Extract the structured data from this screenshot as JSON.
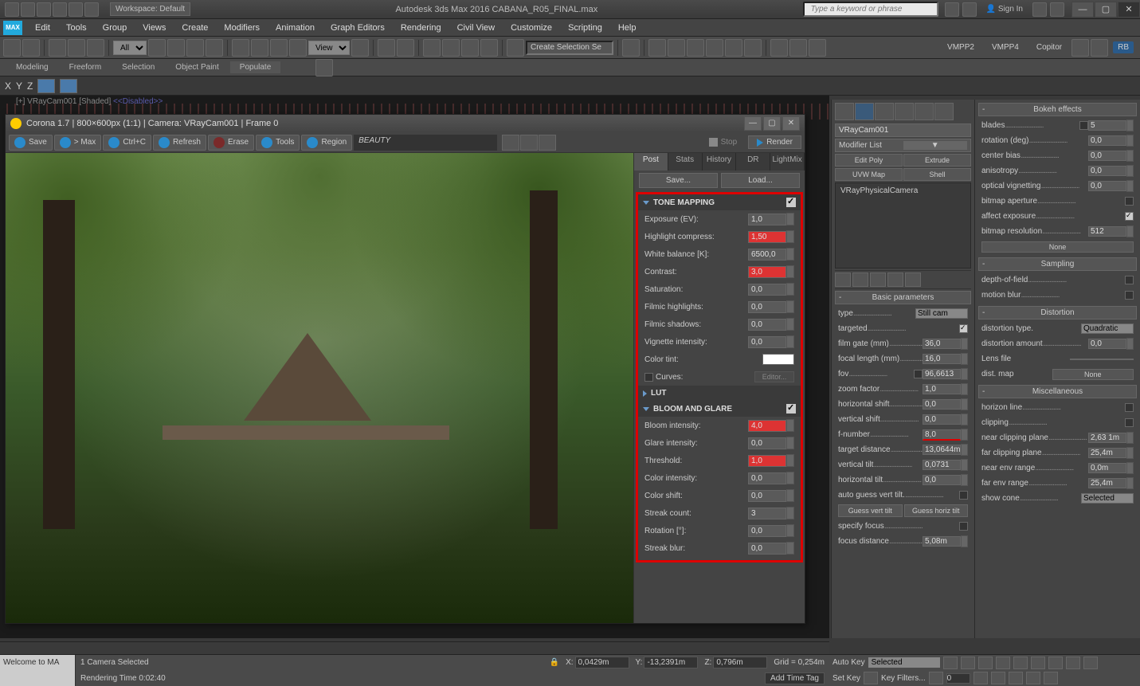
{
  "app": {
    "workspace": "Workspace: Default",
    "title": "Autodesk 3ds Max 2016   CABANA_R05_FINAL.max",
    "search_placeholder": "Type a keyword or phrase",
    "signin": "Sign In"
  },
  "menu": [
    "Edit",
    "Tools",
    "Group",
    "Views",
    "Create",
    "Modifiers",
    "Animation",
    "Graph Editors",
    "Rendering",
    "Civil View",
    "Customize",
    "Scripting",
    "Help"
  ],
  "main_toolbar": {
    "filter": "All",
    "view": "View",
    "selset": "Create Selection Se",
    "right_labels": [
      "VMPP2",
      "VMPP4",
      "Copitor"
    ]
  },
  "ribbon": [
    "Modeling",
    "Freeform",
    "Selection",
    "Object Paint",
    "Populate"
  ],
  "axis": [
    "X",
    "Y",
    "Z"
  ],
  "vp_label": {
    "cam": "[+] VRayCam001",
    "mode": "[Shaded]",
    "disabled": "<<Disabled>>"
  },
  "corona": {
    "title": "Corona 1.7 | 800×600px (1:1) | Camera: VRayCam001 | Frame 0",
    "toolbar": {
      "save": "Save",
      "tomax": "> Max",
      "ctrlc": "Ctrl+C",
      "refresh": "Refresh",
      "erase": "Erase",
      "tools": "Tools",
      "region": "Region",
      "beauty": "BEAUTY",
      "stop": "Stop",
      "render": "Render"
    },
    "tabs": [
      "Post",
      "Stats",
      "History",
      "DR",
      "LightMix"
    ],
    "save_btn": "Save...",
    "load_btn": "Load...",
    "sections": {
      "tone": "TONE MAPPING",
      "lut": "LUT",
      "bloom": "BLOOM AND GLARE"
    },
    "tone_params": [
      {
        "label": "Exposure (EV):",
        "value": "1,0",
        "hl": false
      },
      {
        "label": "Highlight compress:",
        "value": "1,50",
        "hl": true
      },
      {
        "label": "White balance [K]:",
        "value": "6500,0",
        "hl": false
      },
      {
        "label": "Contrast:",
        "value": "3,0",
        "hl": true
      },
      {
        "label": "Saturation:",
        "value": "0,0",
        "hl": false
      },
      {
        "label": "Filmic highlights:",
        "value": "0,0",
        "hl": false
      },
      {
        "label": "Filmic shadows:",
        "value": "0,0",
        "hl": false
      },
      {
        "label": "Vignette intensity:",
        "value": "0,0",
        "hl": false
      }
    ],
    "color_tint": "Color tint:",
    "curves": "Curves:",
    "editor": "Editor...",
    "bloom_params": [
      {
        "label": "Bloom intensity:",
        "value": "4,0",
        "hl": true
      },
      {
        "label": "Glare intensity:",
        "value": "0,0",
        "hl": false
      },
      {
        "label": "Threshold:",
        "value": "1,0",
        "hl": true
      },
      {
        "label": "Color intensity:",
        "value": "0,0",
        "hl": false
      },
      {
        "label": "Color shift:",
        "value": "0,0",
        "hl": false
      },
      {
        "label": "Streak count:",
        "value": "3",
        "hl": false
      },
      {
        "label": "Rotation [°]:",
        "value": "0,0",
        "hl": false
      },
      {
        "label": "Streak blur:",
        "value": "0,0",
        "hl": false
      }
    ]
  },
  "modify": {
    "obj_name": "VRayCam001",
    "modifier_list": "Modifier List",
    "buttons": [
      "Edit Poly",
      "Extrude",
      "UVW Map",
      "Shell"
    ],
    "stack_item": "VRayPhysicalCamera"
  },
  "basic_params": {
    "header": "Basic parameters",
    "rows": [
      {
        "l": "type",
        "v": "Still cam",
        "t": "drop"
      },
      {
        "l": "targeted",
        "t": "chk",
        "on": true
      },
      {
        "l": "film gate (mm)",
        "v": "36,0",
        "t": "spin"
      },
      {
        "l": "focal length (mm)",
        "v": "16,0",
        "t": "spin"
      },
      {
        "l": "fov",
        "v": "96,6613",
        "t": "chkspin"
      },
      {
        "l": "zoom factor",
        "v": "1,0",
        "t": "spin"
      },
      {
        "l": "horizontal shift",
        "v": "0,0",
        "t": "spin"
      },
      {
        "l": "vertical shift",
        "v": "0,0",
        "t": "spin"
      },
      {
        "l": "f-number",
        "v": "8,0",
        "t": "spin",
        "red": true
      },
      {
        "l": "target distance",
        "v": "13,0644m",
        "t": "spin"
      },
      {
        "l": "vertical tilt",
        "v": "0,0731",
        "t": "spin"
      },
      {
        "l": "horizontal tilt",
        "v": "0,0",
        "t": "spin"
      },
      {
        "l": "auto guess vert tilt.",
        "t": "chk",
        "on": false
      }
    ],
    "guess_vert": "Guess vert tilt",
    "guess_horiz": "Guess horiz tilt",
    "specify_focus": "specify focus",
    "focus_distance": {
      "l": "focus distance",
      "v": "5,08m"
    }
  },
  "bokeh": {
    "header": "Bokeh effects",
    "rows": [
      {
        "l": "blades",
        "v": "5",
        "t": "chkspin"
      },
      {
        "l": "rotation (deg)",
        "v": "0,0",
        "t": "spin"
      },
      {
        "l": "center bias",
        "v": "0,0",
        "t": "spin"
      },
      {
        "l": "anisotropy",
        "v": "0,0",
        "t": "spin"
      },
      {
        "l": "optical vignetting",
        "v": "0,0",
        "t": "spin"
      },
      {
        "l": "bitmap aperture",
        "t": "chk"
      },
      {
        "l": "affect exposure",
        "t": "chk",
        "on": true
      },
      {
        "l": "bitmap resolution",
        "v": "512",
        "t": "spin"
      }
    ],
    "none": "None"
  },
  "sampling": {
    "header": "Sampling",
    "rows": [
      {
        "l": "depth-of-field",
        "t": "chk"
      },
      {
        "l": "motion blur",
        "t": "chk"
      }
    ]
  },
  "distortion": {
    "header": "Distortion",
    "type_l": "distortion type.",
    "type_v": "Quadratic",
    "amount_l": "distortion amount",
    "amount_v": "0,0",
    "lens_l": "Lens file",
    "map_l": "dist. map",
    "map_v": "None"
  },
  "misc": {
    "header": "Miscellaneous",
    "rows": [
      {
        "l": "horizon line",
        "t": "chk"
      },
      {
        "l": "clipping",
        "t": "chk"
      },
      {
        "l": "near clipping plane",
        "v": "2,63 1m",
        "t": "spin"
      },
      {
        "l": "far clipping plane",
        "v": "25,4m",
        "t": "spin"
      },
      {
        "l": "near env range",
        "v": "0,0m",
        "t": "spin"
      },
      {
        "l": "far env range",
        "v": "25,4m",
        "t": "spin"
      }
    ],
    "show_cone_l": "show cone",
    "show_cone_v": "Selected"
  },
  "status": {
    "welcome": "Welcome to MA",
    "selection": "1 Camera Selected",
    "rendering": "Rendering Time  0:02:40",
    "x": "0,0429m",
    "y": "-13,2391m",
    "z": "0,796m",
    "grid": "Grid = 0,254m",
    "autokey": "Auto Key",
    "selected": "Selected",
    "setkey": "Set Key",
    "keyfilters": "Key Filters...",
    "timetag": "Add Time Tag"
  }
}
